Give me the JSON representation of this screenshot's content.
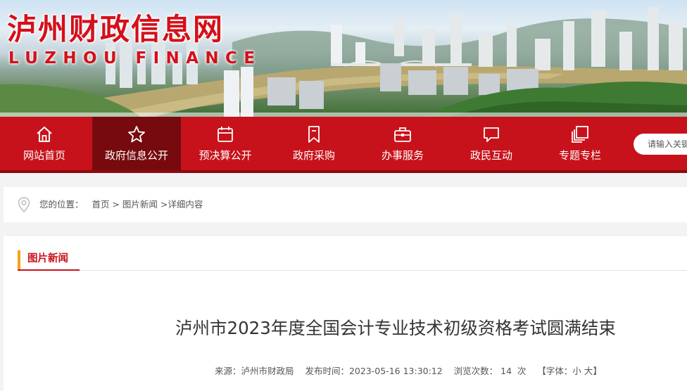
{
  "header": {
    "site_name": "泸州财政信息网",
    "site_subtitle": "LUZHOU FINANCE"
  },
  "nav": {
    "items": [
      {
        "label": "网站首页",
        "icon": "home-icon"
      },
      {
        "label": "政府信息公开",
        "icon": "star-icon"
      },
      {
        "label": "预决算公开",
        "icon": "calendar-icon"
      },
      {
        "label": "政府采购",
        "icon": "bookmark-icon"
      },
      {
        "label": "办事服务",
        "icon": "briefcase-icon"
      },
      {
        "label": "政民互动",
        "icon": "chat-icon"
      },
      {
        "label": "专题专栏",
        "icon": "pages-icon"
      }
    ],
    "active_index": 1,
    "search_placeholder": "请输入关键字"
  },
  "breadcrumb": {
    "prefix": "您的位置：",
    "home": "首页",
    "sep1": " > ",
    "section": "图片新闻",
    "sep2": " >",
    "current": "详细内容"
  },
  "section": {
    "title": "图片新闻"
  },
  "article": {
    "title": "泸州市2023年度全国会计专业技术初级资格考试圆满结束",
    "source_label": "来源：",
    "source": "泸州市财政局",
    "time_label": "发布时间：",
    "time": "2023-05-16 13:30:12",
    "views_label": "浏览次数：",
    "views": "14",
    "views_unit": "次",
    "font_label": "【字体：",
    "font_small": "小",
    "font_large": "大",
    "font_end": "】"
  },
  "colors": {
    "brand_red": "#c8121b",
    "active_nav": "#770a0e",
    "section_accent": "#f2a417"
  }
}
